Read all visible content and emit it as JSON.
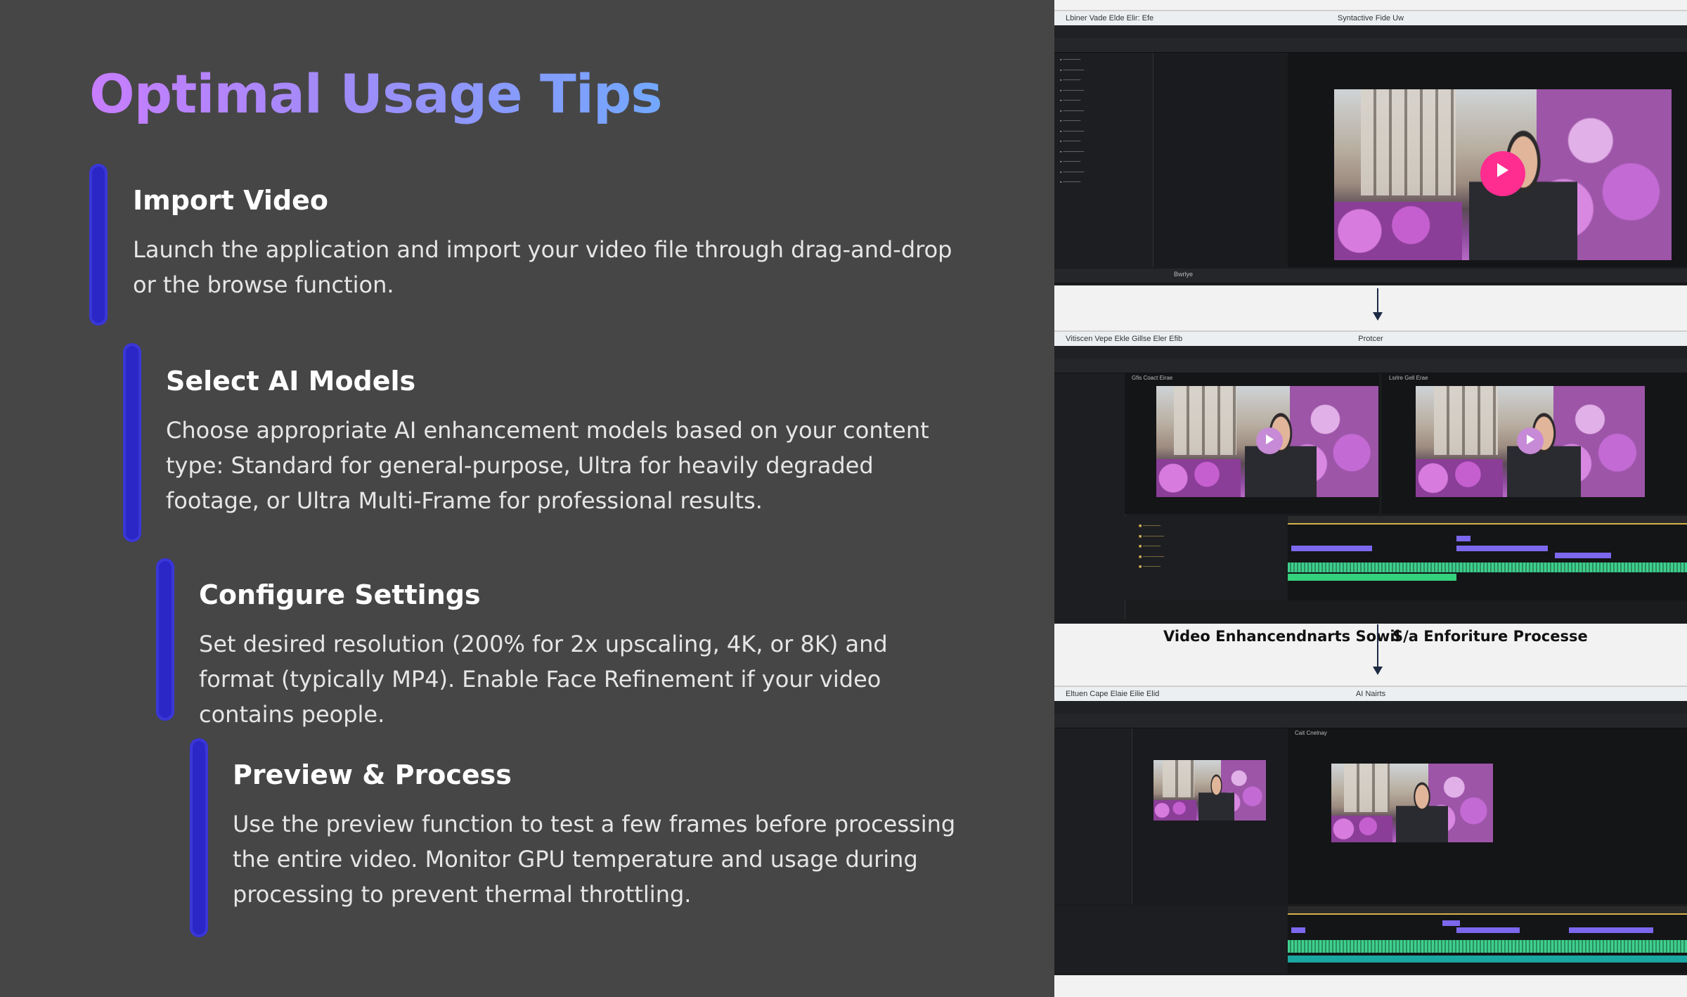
{
  "slide": {
    "title": "Optimal Usage Tips",
    "title_gradient": [
      "#c77dff",
      "#72a8ff"
    ],
    "accent_bar_color": "#2b26c6",
    "steps": [
      {
        "title": "Import Video",
        "desc": "Launch the application and import your video file through drag-and-drop or the browse function."
      },
      {
        "title": "Select AI Models",
        "desc": "Choose appropriate AI enhancement models based on your content type: Standard for general-purpose, Ultra for heavily degraded footage, or Ultra Multi-Frame for professional results."
      },
      {
        "title": "Configure Settings",
        "desc": "Set desired resolution (200% for 2x upscaling, 4K, or 8K) and format (typically MP4). Enable Face Refinement if your video contains people."
      },
      {
        "title": "Preview & Process",
        "desc": "Use the preview function to test a few frames before processing the entire video. Monitor GPU temperature and usage during processing to prevent thermal throttling."
      }
    ]
  },
  "illustration": {
    "window1": {
      "title_left": "Lbiner Vade Elde Elir: Efe",
      "title_center": "Syntactive Fide Uw",
      "bottom_label": "Bwrlye"
    },
    "window2": {
      "title_left": "Vitiscen Vepe Ekle Gillse Eler Efib",
      "title_center": "Protcer",
      "preview_left_label": "Gfis Coact Eirae",
      "preview_right_label": "Lsrlre Gell Erae"
    },
    "window3": {
      "title_left": "Eltuen Cape Elaie Eilie Elid",
      "title_center": "AI Nairts",
      "preview_label": "Cait Cnelnay"
    },
    "caption_left": "Video Enhancendnarts Sowil",
    "caption_right": "S/a Enforiture Processe"
  }
}
